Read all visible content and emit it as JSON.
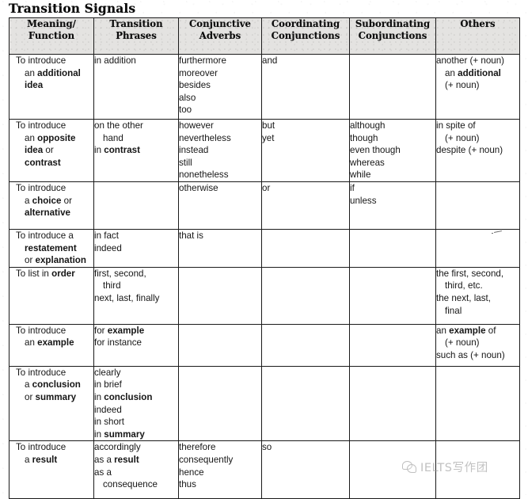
{
  "document": {
    "title": "Transition Signals"
  },
  "table": {
    "headers": [
      {
        "line1": "Meaning/",
        "line2": "Function"
      },
      {
        "line1": "Transition",
        "line2": "Phrases"
      },
      {
        "line1": "Conjunctive",
        "line2": "Adverbs"
      },
      {
        "line1": "Coordinating",
        "line2": "Conjunctions"
      },
      {
        "line1": "Subordinating",
        "line2": "Conjunctions"
      },
      {
        "line1": "Others",
        "line2": ""
      }
    ],
    "rows": [
      {
        "function": [
          "To introduce",
          "an additional",
          "idea"
        ],
        "transition_phrases": [
          "in addition"
        ],
        "conjunctive_adverbs": [
          "furthermore",
          "moreover",
          "besides",
          "also",
          "too"
        ],
        "coordinating_conjunctions": [
          "and"
        ],
        "subordinating_conjunctions": [],
        "others": [
          "another (+ noun)",
          "an additional",
          "(+ noun)"
        ]
      },
      {
        "function": [
          "To introduce",
          "an opposite",
          "idea or",
          "contrast"
        ],
        "transition_phrases": [
          "on the other",
          "hand",
          "in contrast"
        ],
        "conjunctive_adverbs": [
          "however",
          "nevertheless",
          "instead",
          "still",
          "nonetheless"
        ],
        "coordinating_conjunctions": [
          "but",
          "yet"
        ],
        "subordinating_conjunctions": [
          "although",
          "though",
          "even though",
          "whereas",
          "while"
        ],
        "others": [
          "in spite of",
          "(+ noun)",
          "despite (+ noun)"
        ]
      },
      {
        "function": [
          "To introduce",
          "a choice or",
          "alternative"
        ],
        "transition_phrases": [],
        "conjunctive_adverbs": [
          "otherwise"
        ],
        "coordinating_conjunctions": [
          "or"
        ],
        "subordinating_conjunctions": [
          "if",
          "unless"
        ],
        "others": []
      },
      {
        "function": [
          "To introduce a",
          "restatement",
          "or explanation"
        ],
        "transition_phrases": [
          "in fact",
          "indeed"
        ],
        "conjunctive_adverbs": [
          "that is"
        ],
        "coordinating_conjunctions": [],
        "subordinating_conjunctions": [],
        "others": []
      },
      {
        "function": [
          "To list in order"
        ],
        "transition_phrases": [
          "first, second,",
          "third",
          "next, last, finally"
        ],
        "conjunctive_adverbs": [],
        "coordinating_conjunctions": [],
        "subordinating_conjunctions": [],
        "others": [
          "the first, second,",
          "third, etc.",
          "the next, last,",
          "final"
        ]
      },
      {
        "function": [
          "To introduce",
          "an example"
        ],
        "transition_phrases": [
          "for example",
          "for instance"
        ],
        "conjunctive_adverbs": [],
        "coordinating_conjunctions": [],
        "subordinating_conjunctions": [],
        "others": [
          "an example of",
          "(+ noun)",
          "such as (+ noun)"
        ]
      },
      {
        "function": [
          "To introduce",
          "a conclusion",
          "or summary"
        ],
        "transition_phrases": [
          "clearly",
          "in brief",
          "in conclusion",
          "indeed",
          "in short",
          "in summary"
        ],
        "conjunctive_adverbs": [],
        "coordinating_conjunctions": [],
        "subordinating_conjunctions": [],
        "others": []
      },
      {
        "function": [
          "To introduce",
          "a result"
        ],
        "transition_phrases": [
          "accordingly",
          "as a result",
          "as a",
          "consequence"
        ],
        "conjunctive_adverbs": [
          "therefore",
          "consequently",
          "hence",
          "thus"
        ],
        "coordinating_conjunctions": [
          "so"
        ],
        "subordinating_conjunctions": [],
        "others": []
      }
    ]
  },
  "watermark": {
    "icon": "wechat-icon",
    "text": "IELTS写作团"
  }
}
